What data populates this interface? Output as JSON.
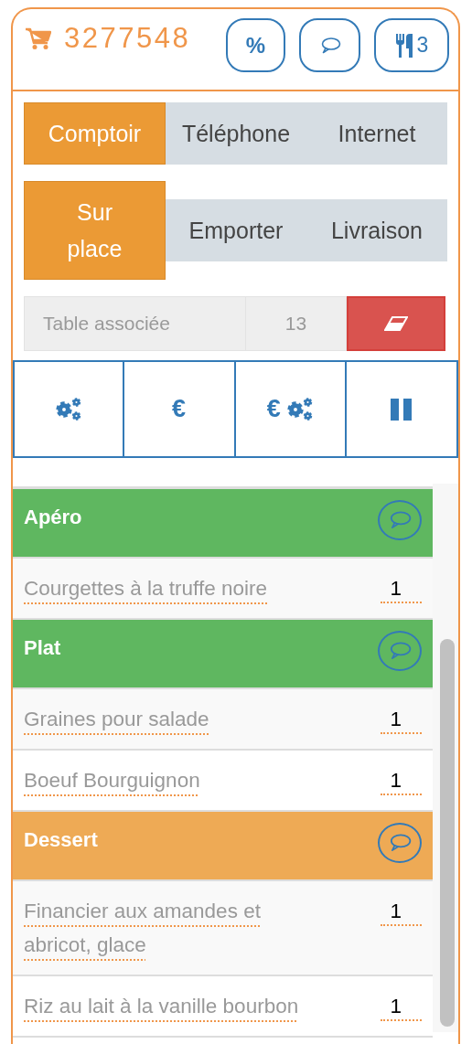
{
  "header": {
    "order_number": "3277548",
    "buttons": [
      {
        "kind": "percent",
        "label": "%"
      },
      {
        "kind": "comment"
      },
      {
        "kind": "covers",
        "label": "3"
      }
    ]
  },
  "channels": [
    {
      "label": "Comptoir",
      "selected": true
    },
    {
      "label": "Téléphone",
      "selected": false
    },
    {
      "label": "Internet",
      "selected": false
    }
  ],
  "service_modes": [
    {
      "label": "Sur place",
      "selected": true
    },
    {
      "label": "Emporter",
      "selected": false
    },
    {
      "label": "Livraison",
      "selected": false
    }
  ],
  "table": {
    "label": "Table associée",
    "value": "13"
  },
  "actions": [
    {
      "kind": "gears"
    },
    {
      "kind": "euro",
      "label": "€"
    },
    {
      "kind": "euro-gears",
      "label": "€"
    },
    {
      "kind": "pause"
    }
  ],
  "categories": [
    {
      "name": "Apéro",
      "color": "#5fb760",
      "items": [
        {
          "name": "Courgettes à la truffe noire",
          "quantity": "1"
        }
      ]
    },
    {
      "name": "Plat",
      "color": "#5fb760",
      "items": [
        {
          "name": "Graines pour salade",
          "quantity": "1"
        },
        {
          "name": "Boeuf Bourguignon",
          "quantity": "1"
        }
      ]
    },
    {
      "name": "Dessert",
      "color": "#eeaa55",
      "items": [
        {
          "name": "Financier aux amandes et abricot, glace",
          "quantity": "1"
        },
        {
          "name": "Riz au lait à la vanille bourbon",
          "quantity": "1"
        }
      ]
    }
  ]
}
